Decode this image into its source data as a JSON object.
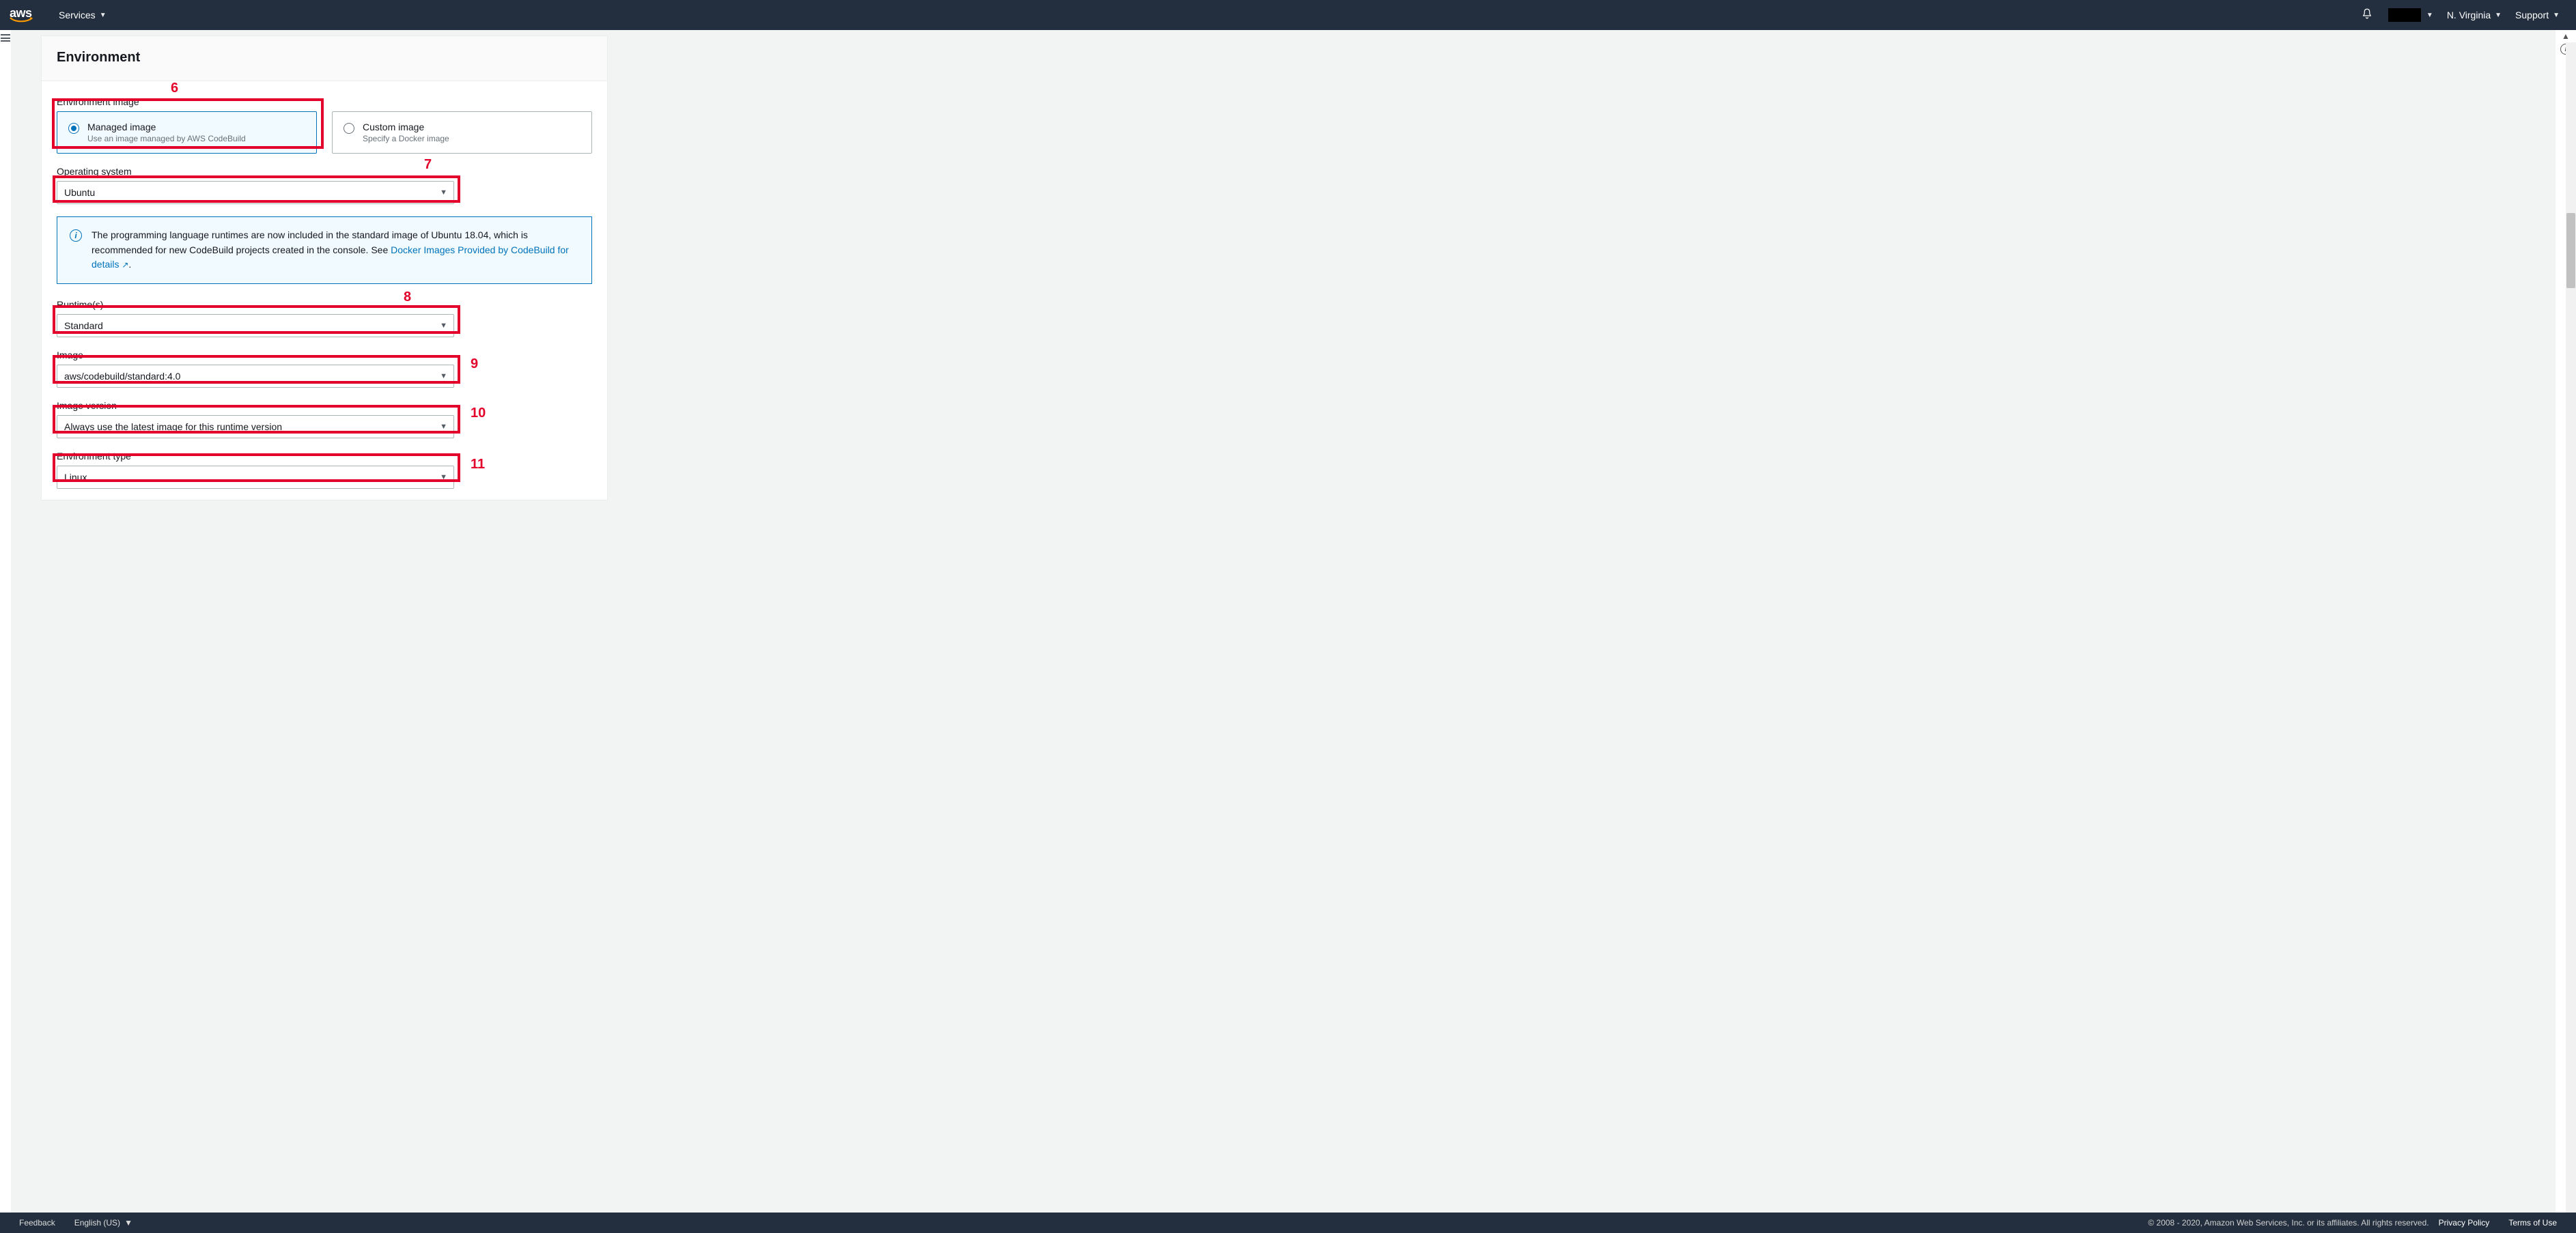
{
  "topnav": {
    "services": "Services",
    "region": "N. Virginia",
    "support": "Support"
  },
  "panel": {
    "title": "Environment",
    "env_image_label": "Environment image",
    "managed": {
      "title": "Managed image",
      "desc": "Use an image managed by AWS CodeBuild"
    },
    "custom": {
      "title": "Custom image",
      "desc": "Specify a Docker image"
    },
    "os_label": "Operating system",
    "os_value": "Ubuntu",
    "callout_pre": "The programming language runtimes are now included in the standard image of Ubuntu 18.04, which is recommended for new CodeBuild projects created in the console. See ",
    "callout_link": "Docker Images Provided by CodeBuild for details",
    "runtime_label": "Runtime(s)",
    "runtime_value": "Standard",
    "image_label": "Image",
    "image_value": "aws/codebuild/standard:4.0",
    "imgver_label": "Image version",
    "imgver_value": "Always use the latest image for this runtime version",
    "envtype_label": "Environment type",
    "envtype_value": "Linux"
  },
  "annotations": {
    "n6": "6",
    "n7": "7",
    "n8": "8",
    "n9": "9",
    "n10": "10",
    "n11": "11"
  },
  "footer": {
    "feedback": "Feedback",
    "lang": "English (US)",
    "copy": "© 2008 - 2020, Amazon Web Services, Inc. or its affiliates. All rights reserved.",
    "privacy": "Privacy Policy",
    "terms": "Terms of Use"
  }
}
